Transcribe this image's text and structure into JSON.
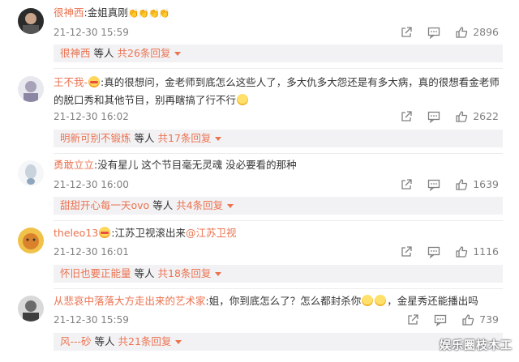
{
  "comments": [
    {
      "user": "很神西",
      "text": ":金姐真刚",
      "time": "21-12-30 15:59",
      "likes": "2896",
      "reply": {
        "user": "很神西",
        "others": "等人",
        "more": "共26条回复"
      }
    },
    {
      "user": "王不我-",
      "text": ":真的很想问，金老师到底怎么这些人了，多大仇多大怨还是有多大病，真的很想看金老师的脱口秀和其他节目，别再瞎搞了行不行",
      "time": "21-12-30 16:02",
      "likes": "2622",
      "reply": {
        "user": "明新可别不锻炼",
        "others": "等人",
        "more": "共17条回复"
      }
    },
    {
      "user": "勇敢立立",
      "text": ":没有星儿 这个节目毫无灵魂 没必要看的那种",
      "time": "21-12-30 16:00",
      "likes": "1639",
      "reply": {
        "user": "甜甜开心每一天ovo",
        "others": "等人",
        "more": "共4条回复"
      }
    },
    {
      "user": "theleo13",
      "text": ":江苏卫视滚出来",
      "mention": "@江苏卫视",
      "time": "21-12-30 16:01",
      "likes": "1116",
      "reply": {
        "user": "怀旧也要正能量",
        "others": "等人",
        "more": "共18条回复"
      }
    },
    {
      "user": "从悲哀中落落大方走出来的艺术家",
      "text_a": ":姐，你到底怎么了？怎么都封杀你",
      "text_b": "，金星秀还能播出吗",
      "time": "21-12-30 15:59",
      "likes": "739",
      "reply": {
        "user": "风---砂",
        "others": "等人",
        "more": "共21条回复"
      }
    }
  ],
  "watermark": "娱乐圈枝木工"
}
